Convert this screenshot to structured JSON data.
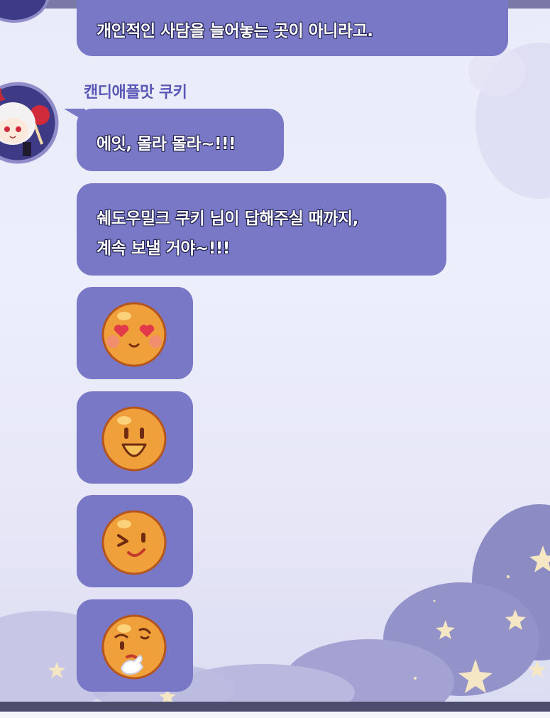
{
  "chat": {
    "previous_message_tail": "개인적인 사담을 늘어놓는 곳이 아니라고.",
    "sender": {
      "name": "캔디애플맛 쿠키",
      "avatar_icon": "candy-apple-cookie-avatar"
    },
    "messages": [
      {
        "type": "text",
        "lines": [
          "에잇, 몰라 몰라~!!!"
        ]
      },
      {
        "type": "text",
        "lines": [
          "쉐도우밀크 쿠키 님이 답해주실 때까지,",
          "계속 보낼 거야~!!!"
        ]
      },
      {
        "type": "emoji",
        "icon": "heart-eyes-emoji"
      },
      {
        "type": "emoji",
        "icon": "big-smile-emoji"
      },
      {
        "type": "emoji",
        "icon": "wink-emoji"
      },
      {
        "type": "emoji",
        "icon": "thinking-emoji"
      }
    ]
  },
  "colors": {
    "bubble": "#7978c7",
    "sender_name": "#5a57b7",
    "background": "#eceefb",
    "emoji_face": "#f0a03a"
  }
}
